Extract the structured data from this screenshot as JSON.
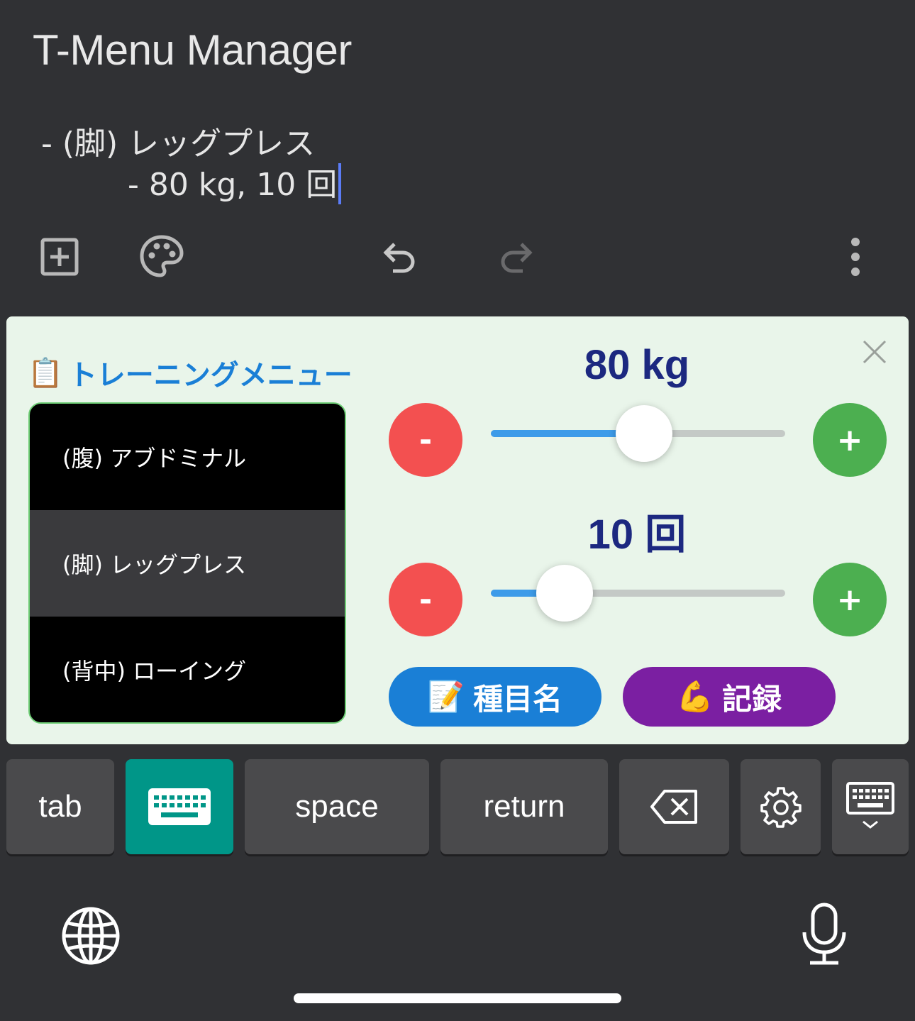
{
  "app": {
    "title": "T-Menu Manager"
  },
  "note": {
    "line1": "- (脚) レッグプレス",
    "line2": "- 80 kg, 10 回"
  },
  "toolbar": {
    "icons": [
      "add-box-icon",
      "palette-icon",
      "undo-icon",
      "redo-icon",
      "more-vert-icon"
    ]
  },
  "panel": {
    "title": "トレーニングメニュー",
    "title_icon": "📋",
    "menu_items": [
      {
        "label": "(腹) アブドミナル",
        "selected": false
      },
      {
        "label": "(脚) レッグプレス",
        "selected": true
      },
      {
        "label": "(背中) ローイング",
        "selected": false
      }
    ],
    "weight": {
      "label": "80 kg",
      "slider_fraction": 0.52
    },
    "reps": {
      "label": "10 回",
      "slider_fraction": 0.25
    },
    "minus_label": "-",
    "plus_label": "+",
    "name_button": {
      "icon": "📝",
      "label": "種目名"
    },
    "record_button": {
      "icon": "💪",
      "label": "記録"
    }
  },
  "keyboard": {
    "tab": "tab",
    "space": "space",
    "return": "return"
  },
  "colors": {
    "accent_blue": "#1a7fd6",
    "minus_red": "#f35050",
    "plus_green": "#4caf50",
    "record_purple": "#7b1fa2",
    "keyboard_active": "#009688"
  }
}
